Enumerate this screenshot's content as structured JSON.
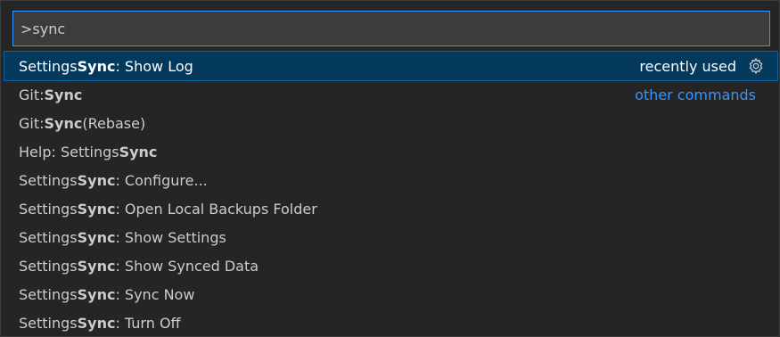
{
  "search": {
    "value": ">sync"
  },
  "items": [
    {
      "pre": "Settings ",
      "bold": "Sync",
      "post": ": Show Log",
      "right": "recently used",
      "gear": "gear-icon"
    },
    {
      "pre": "Git: ",
      "bold": "Sync",
      "post": "",
      "right": "other commands"
    },
    {
      "pre": "Git: ",
      "bold": "Sync",
      "post": " (Rebase)"
    },
    {
      "pre": "Help: Settings ",
      "bold": "Sync",
      "post": ""
    },
    {
      "pre": "Settings ",
      "bold": "Sync",
      "post": ": Configure..."
    },
    {
      "pre": "Settings ",
      "bold": "Sync",
      "post": ": Open Local Backups Folder"
    },
    {
      "pre": "Settings ",
      "bold": "Sync",
      "post": ": Show Settings"
    },
    {
      "pre": "Settings ",
      "bold": "Sync",
      "post": ": Show Synced Data"
    },
    {
      "pre": "Settings ",
      "bold": "Sync",
      "post": ": Sync Now"
    },
    {
      "pre": "Settings ",
      "bold": "Sync",
      "post": ": Turn Off"
    }
  ],
  "colors": {
    "selected_bg": "#04395e",
    "link": "#3794ff",
    "focus_border": "#3794ff"
  }
}
